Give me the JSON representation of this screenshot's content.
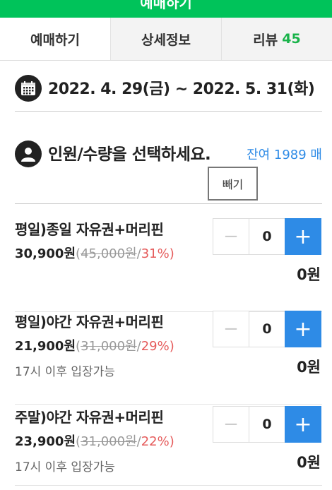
{
  "header": {
    "title": "예매하기"
  },
  "tabs": [
    {
      "label": "예매하기"
    },
    {
      "label": "상세정보"
    },
    {
      "label": "리뷰",
      "count": "45"
    }
  ],
  "date_range": "2022. 4. 29(금) ~ 2022. 5. 31(화)",
  "selection": {
    "title": "인원/수량을 선택하세요.",
    "remaining": "잔여 1989 매",
    "subtract_label": "빼기"
  },
  "tickets": [
    {
      "name": "평일)종일 자유권+머리핀",
      "price": "30,900원",
      "original": "45,000원",
      "discount": "31%",
      "note": "",
      "qty": "0",
      "total": "0원"
    },
    {
      "name": "평일)야간 자유권+머리핀",
      "price": "21,900원",
      "original": "31,000원",
      "discount": "29%",
      "note": "17시 이후 입장가능",
      "qty": "0",
      "total": "0원"
    },
    {
      "name": "주말)야간 자유권+머리핀",
      "price": "23,900원",
      "original": "31,000원",
      "discount": "22%",
      "note": "17시 이후 입장가능",
      "qty": "0",
      "total": "0원"
    }
  ],
  "icons": {
    "calendar": "calendar-icon",
    "person": "person-icon",
    "minus": "minus-icon",
    "plus": "plus-icon"
  },
  "colors": {
    "brand": "#00c35a",
    "accent_blue": "#2e8be6",
    "discount_red": "#e55a5a",
    "review_green": "#19b34a"
  }
}
